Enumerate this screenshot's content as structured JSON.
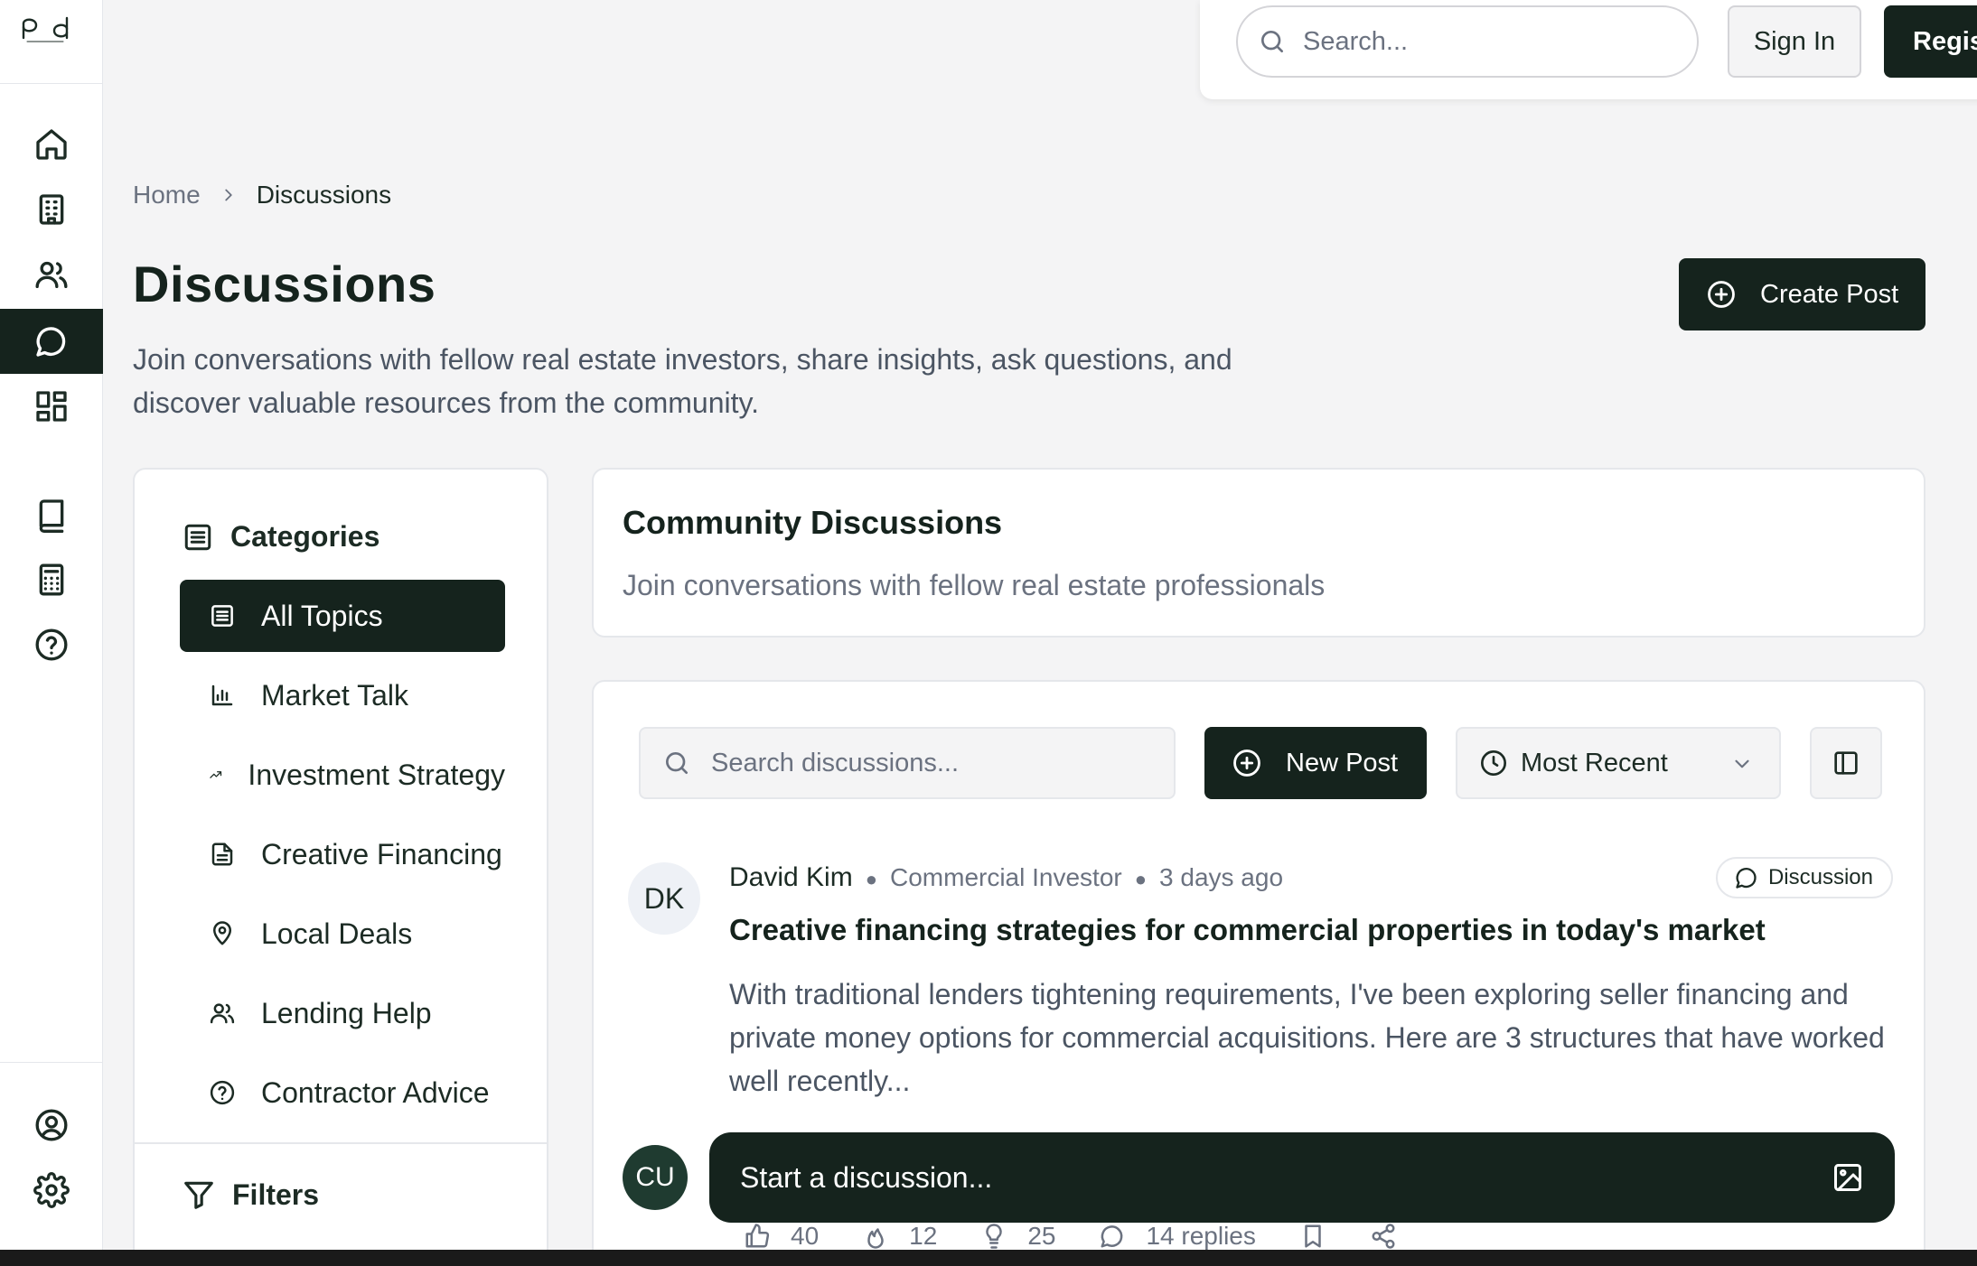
{
  "topbar": {
    "search_placeholder": "Search...",
    "signin_label": "Sign In",
    "register_label": "Regist"
  },
  "breadcrumb": {
    "home": "Home",
    "current": "Discussions"
  },
  "header": {
    "title": "Discussions",
    "description": "Join conversations with fellow real estate investors, share insights, ask questions, and discover valuable resources from the community.",
    "create_post_label": "Create Post"
  },
  "sidebar": {
    "icons": [
      "home-icon",
      "building-icon",
      "users-icon",
      "message-icon",
      "dashboard-icon",
      "book-icon",
      "calculator-icon",
      "help-icon",
      "user-circle-icon",
      "settings-icon"
    ],
    "active": "message-icon"
  },
  "categories": {
    "heading": "Categories",
    "items": [
      {
        "label": "All Topics",
        "icon": "list-icon",
        "active": true
      },
      {
        "label": "Market Talk",
        "icon": "bar-chart-icon"
      },
      {
        "label": "Investment Strategy",
        "icon": "trending-up-icon"
      },
      {
        "label": "Creative Financing",
        "icon": "file-text-icon"
      },
      {
        "label": "Local Deals",
        "icon": "map-pin-icon"
      },
      {
        "label": "Lending Help",
        "icon": "users-icon"
      },
      {
        "label": "Contractor Advice",
        "icon": "help-circle-icon"
      }
    ],
    "filters_heading": "Filters"
  },
  "community": {
    "title": "Community Discussions",
    "subtitle": "Join conversations with fellow real estate professionals"
  },
  "feed": {
    "search_placeholder": "Search discussions...",
    "new_post_label": "New Post",
    "sort_value": "Most Recent",
    "post": {
      "avatar_initials": "DK",
      "author": "David Kim",
      "role": "Commercial Investor",
      "time": "3 days ago",
      "badge": "Discussion",
      "title": "Creative financing strategies for commercial properties in today's market",
      "body": "With traditional lenders tightening requirements, I've been exploring seller financing and private money options for commercial acquisitions. Here are 3 structures that have worked well recently...",
      "likes": "40",
      "fire": "12",
      "ideas": "25",
      "replies": "14 replies"
    }
  },
  "composer": {
    "avatar_initials": "CU",
    "placeholder": "Start a discussion..."
  },
  "colors": {
    "primary": "#15231d",
    "muted": "#6b7280",
    "border": "#e5e7eb"
  }
}
